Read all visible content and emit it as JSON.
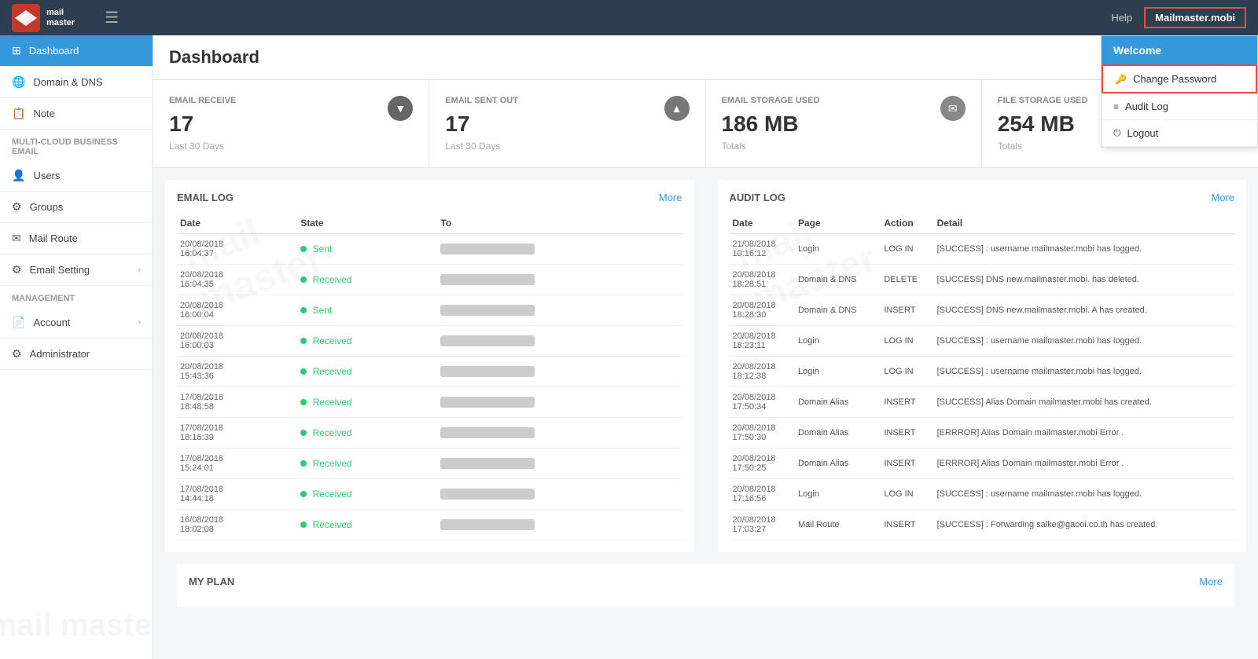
{
  "app": {
    "name": "mail master",
    "logo_text": "mail\nmaster"
  },
  "navbar": {
    "hamburger_icon": "☰",
    "help_label": "Help",
    "username": "Mailmaster.mobi"
  },
  "dropdown": {
    "welcome_label": "Welcome",
    "change_password_label": "Change Password",
    "audit_log_label": "Audit Log",
    "logout_label": "Logout",
    "key_icon": "🔑",
    "list_icon": "≡",
    "power_icon": "⏻"
  },
  "sidebar": {
    "items": [
      {
        "label": "Dashboard",
        "icon": "⊞",
        "active": true
      },
      {
        "label": "Domain & DNS",
        "icon": "🌐",
        "active": false
      },
      {
        "label": "Note",
        "icon": "📋",
        "active": false
      }
    ],
    "section_cloud": "Multi-Cloud Business Email",
    "cloud_items": [
      {
        "label": "Users",
        "icon": "👤",
        "active": false
      },
      {
        "label": "Groups",
        "icon": "⚙",
        "active": false
      },
      {
        "label": "Mail Route",
        "icon": "✉",
        "active": false
      },
      {
        "label": "Email Setting",
        "icon": "⚙",
        "active": false,
        "has_arrow": true
      }
    ],
    "section_management": "Management",
    "management_items": [
      {
        "label": "Account",
        "icon": "📄",
        "active": false,
        "has_arrow": true
      },
      {
        "label": "Administrator",
        "icon": "⚙",
        "active": false
      }
    ]
  },
  "main": {
    "title": "Dashboard"
  },
  "stats": [
    {
      "label": "EMAIL RECEIVE",
      "value": "17",
      "sub": "Last 30 Days",
      "icon": "▼",
      "icon_type": "down"
    },
    {
      "label": "EMAIL SENT OUT",
      "value": "17",
      "sub": "Last 30 Days",
      "icon": "▲",
      "icon_type": "up"
    },
    {
      "label": "EMAIL STORAGE USED",
      "value": "186 MB",
      "sub": "Totals",
      "icon": "✉",
      "icon_type": "envelope"
    },
    {
      "label": "FILE STORAGE USED",
      "value": "254 MB",
      "sub": "Totals",
      "icon": "📄",
      "icon_type": "file"
    }
  ],
  "email_log": {
    "title": "EMAIL LOG",
    "more_label": "More",
    "columns": [
      "Date",
      "State",
      "To"
    ],
    "rows": [
      {
        "date": "20/08/2018\n16:04:37",
        "state": "Sent",
        "state_color": "green"
      },
      {
        "date": "20/08/2018\n16:04:35",
        "state": "Received",
        "state_color": "green"
      },
      {
        "date": "20/08/2018\n16:00:04",
        "state": "Sent",
        "state_color": "green"
      },
      {
        "date": "20/08/2018\n16:00:03",
        "state": "Received",
        "state_color": "green"
      },
      {
        "date": "20/08/2018\n15:43:36",
        "state": "Received",
        "state_color": "green"
      },
      {
        "date": "17/08/2018\n18:48:58",
        "state": "Received",
        "state_color": "green"
      },
      {
        "date": "17/08/2018\n18:16:39",
        "state": "Received",
        "state_color": "green"
      },
      {
        "date": "17/08/2018\n15:24:01",
        "state": "Received",
        "state_color": "green"
      },
      {
        "date": "17/08/2018\n14:44:18",
        "state": "Received",
        "state_color": "green"
      },
      {
        "date": "16/08/2018\n18:02:08",
        "state": "Received",
        "state_color": "green"
      }
    ]
  },
  "audit_log": {
    "title": "AUDIT LOG",
    "more_label": "More",
    "columns": [
      "Date",
      "Page",
      "Action",
      "Detail"
    ],
    "rows": [
      {
        "date": "21/08/2018\n10:16:12",
        "page": "Login",
        "action": "LOG IN",
        "detail": "[SUCCESS] : username mailmaster.mobi has logged."
      },
      {
        "date": "20/08/2018\n18:28:51",
        "page": "Domain & DNS",
        "action": "DELETE",
        "detail": "[SUCCESS] DNS new.mailmaster.mobi. has deleted."
      },
      {
        "date": "20/08/2018\n18:28:30",
        "page": "Domain & DNS",
        "action": "INSERT",
        "detail": "[SUCCESS] DNS new.mailmaster.mobi. A has created."
      },
      {
        "date": "20/08/2018\n18:23:11",
        "page": "Login",
        "action": "LOG IN",
        "detail": "[SUCCESS] : username mailmaster.mobi has logged."
      },
      {
        "date": "20/08/2018\n18:12:38",
        "page": "Login",
        "action": "LOG IN",
        "detail": "[SUCCESS] : username mailmaster.mobi has logged."
      },
      {
        "date": "20/08/2018\n17:50:34",
        "page": "Domain Alias",
        "action": "INSERT",
        "detail": "[SUCCESS] Alias Domain mailmaster.mobi has created."
      },
      {
        "date": "20/08/2018\n17:50:30",
        "page": "Domain Alias",
        "action": "INSERT",
        "detail": "[ERRROR] Alias Domain mailmaster.mobi Error ."
      },
      {
        "date": "20/08/2018\n17:50:25",
        "page": "Domain Alias",
        "action": "INSERT",
        "detail": "[ERRROR] Alias Domain mailmaster.mobi Error ."
      },
      {
        "date": "20/08/2018\n17:16:56",
        "page": "Login",
        "action": "LOG IN",
        "detail": "[SUCCESS] : username mailmaster.mobi has logged."
      },
      {
        "date": "20/08/2018\n17:03:27",
        "page": "Mail Route",
        "action": "INSERT",
        "detail": "[SUCCESS] : Forwarding salke@gaooi.co.th has created."
      }
    ]
  },
  "my_plan": {
    "title": "MY PLAN",
    "more_label": "More"
  }
}
